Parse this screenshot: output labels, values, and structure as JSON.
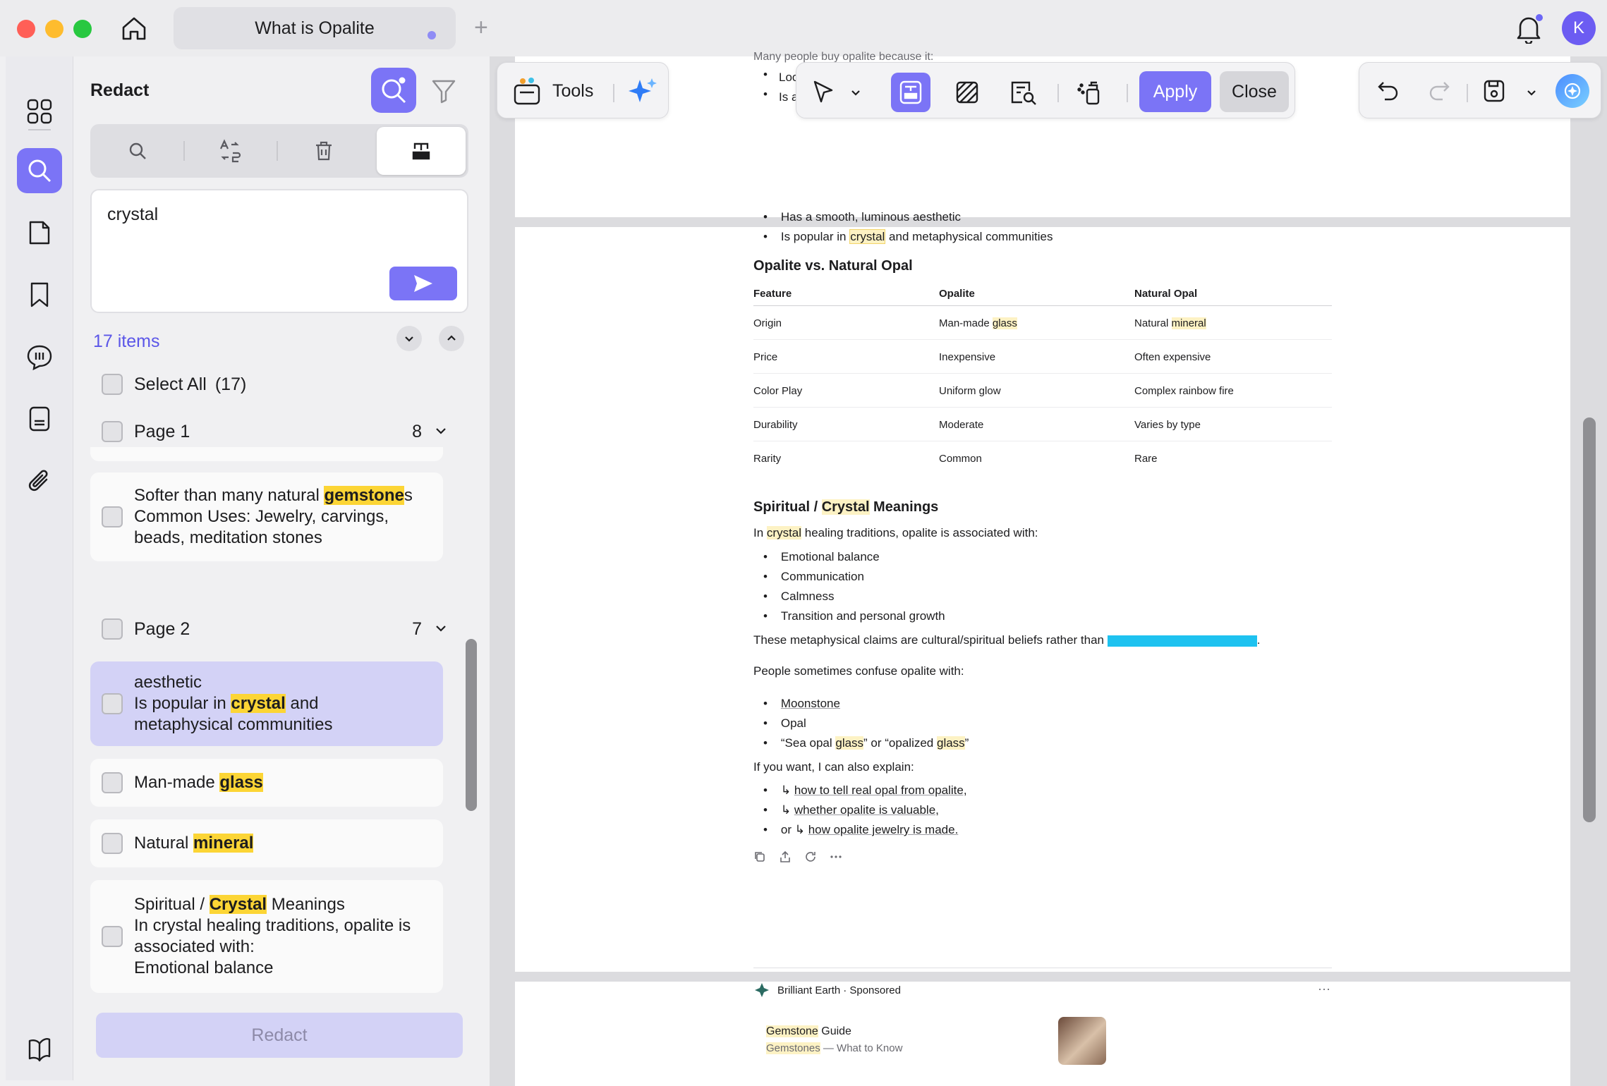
{
  "window": {
    "tab_title": "What is Opalite",
    "avatar_initial": "K"
  },
  "panel": {
    "title": "Redact",
    "query": "crystal",
    "items_count": "17 items",
    "select_all_label": "Select All",
    "select_all_count": "(17)",
    "redact_label": "Redact",
    "groups": [
      {
        "label": "Page 1",
        "count": "8"
      },
      {
        "label": "Page 2",
        "count": "7"
      }
    ],
    "results": {
      "r1_line1_pre": "Softer than many natural ",
      "r1_line1_hl": "gemstone",
      "r1_line1_post": "s",
      "r1_line2": "Common Uses: Jewelry, carvings,",
      "r1_line3": "beads, meditation stones",
      "r2_line1": "aesthetic",
      "r2_line2_pre": "Is popular in ",
      "r2_line2_hl": "crystal",
      "r2_line2_post": " and",
      "r2_line3": "metaphysical communities",
      "r3_pre": "Man-made ",
      "r3_hl": "glass",
      "r4_pre": "Natural ",
      "r4_hl": "mineral",
      "r5_line1_pre": "Spiritual / ",
      "r5_line1_hl": "Crystal",
      "r5_line1_post": " Meanings",
      "r5_line2": "In crystal healing traditions, opalite is",
      "r5_line3": "associated with:",
      "r5_line4": "Emotional balance"
    }
  },
  "toolbar": {
    "tools_label": "Tools",
    "apply_label": "Apply",
    "close_label": "Close"
  },
  "document": {
    "top_partial": "Many people buy opalite because it:",
    "top_bullet1": "Loo",
    "top_bullet2": "Is a",
    "bullet_smooth": "Has a smooth, luminous aesthetic",
    "bullet_popular_pre": "Is popular in ",
    "bullet_popular_hl": "crystal",
    "bullet_popular_post": " and metaphysical communities",
    "compare_heading": "Opalite vs. Natural Opal",
    "table_headers": [
      "Feature",
      "Opalite",
      "Natural Opal"
    ],
    "table_rows": [
      [
        "Origin",
        "Man-made glass",
        "Natural mineral"
      ],
      [
        "Price",
        "Inexpensive",
        "Often expensive"
      ],
      [
        "Color Play",
        "Uniform glow",
        "Complex rainbow fire"
      ],
      [
        "Durability",
        "Moderate",
        "Varies by type"
      ],
      [
        "Rarity",
        "Common",
        "Rare"
      ]
    ],
    "spiritual_heading_pre": "Spiritual / ",
    "spiritual_heading_hl": "Crystal",
    "spiritual_heading_post": " Meanings",
    "intro_pre": "In ",
    "intro_hl": "crystal",
    "intro_post": " healing traditions, opalite is associated with:",
    "meanings": [
      "Emotional balance",
      "Communication",
      "Calmness",
      "Transition and personal growth"
    ],
    "claims_text": "These metaphysical claims are cultural/spiritual beliefs rather than",
    "confuse_text": "People sometimes confuse opalite with:",
    "confuse_items": [
      "Moonstone",
      "Opal"
    ],
    "sea_opal_1": "“Sea opal ",
    "sea_opal_hl1": "glass",
    "sea_opal_2": "” or “opalized ",
    "sea_opal_hl2": "glass",
    "sea_opal_3": "”",
    "explain_text": "If you want, I can also explain:",
    "explain_items": [
      "how to tell real opal from opalite,",
      "whether opalite is valuable,",
      "how opalite jewelry is made."
    ],
    "explain_or": "or",
    "sponsor_name": "Brilliant Earth",
    "sponsor_tag": "· Sponsored",
    "ad_title_hl": "Gemstone",
    "ad_title_post": " Guide",
    "ad_sub_hl": "Gemstones",
    "ad_sub_post": " — What to Know"
  }
}
